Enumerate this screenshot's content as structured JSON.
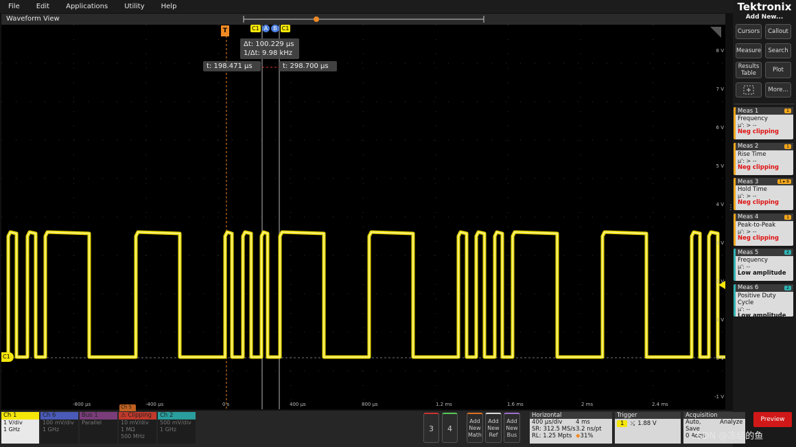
{
  "menu": [
    "File",
    "Edit",
    "Applications",
    "Utility",
    "Help"
  ],
  "waveform_title": "Waveform View",
  "brand": "Tektronix",
  "add_new": "Add New...",
  "side_buttons": [
    "Cursors",
    "Callout",
    "Measure",
    "Search",
    "Results Table",
    "Plot",
    "More..."
  ],
  "trigger_marker": "T",
  "cursor_tags": [
    "C1",
    "A",
    "B",
    "C1"
  ],
  "ch1_tag": "C1",
  "cursor_readouts": {
    "delta_t": "Δt: 100.229 µs",
    "inv_delta_t": "1/Δt: 9.98 kHz",
    "ta": "t: 198.471 µs",
    "tb": "t: 298.700 µs"
  },
  "volt_labels": [
    "8 V",
    "7 V",
    "6 V",
    "5 V",
    "4 V",
    "3 V",
    "2 V",
    "1 V",
    "0 V",
    "-1 V"
  ],
  "time_labels": [
    "-800 µs",
    "-400 µs",
    "0 s",
    "400 µs",
    "800 µs",
    "1.2 ms",
    "1.6 ms",
    "2 ms",
    "2.4 ms"
  ],
  "measurements": [
    {
      "title": "Meas 1",
      "name": "Frequency",
      "mu": "µ': > --",
      "status": "Neg clipping",
      "badge": "1",
      "badge_color": "#f2a71e",
      "status_color": "#e01010"
    },
    {
      "title": "Meas 2",
      "name": "Rise Time",
      "mu": "µ': > --",
      "status": "Neg clipping",
      "badge": "1",
      "badge_color": "#f2a71e",
      "status_color": "#e01010"
    },
    {
      "title": "Meas 3",
      "name": "Hold Time",
      "mu": "µ': > --",
      "status": "Neg clipping",
      "badge": "1 ▸ 6",
      "badge_color": "#f2a71e",
      "status_color": "#e01010"
    },
    {
      "title": "Meas 4",
      "name": "Peak-to-Peak",
      "mu": "µ': > --",
      "status": "Neg clipping",
      "badge": "1",
      "badge_color": "#f2a71e",
      "status_color": "#e01010"
    },
    {
      "title": "Meas 5",
      "name": "Frequency",
      "mu": "µ': --",
      "status": "Low amplitude",
      "badge": "2",
      "badge_color": "#31b3b3",
      "status_color": "#111111"
    },
    {
      "title": "Meas 6",
      "name": "Positive Duty Cycle",
      "mu": "µ': --",
      "status": "Low amplitude",
      "badge": "2",
      "badge_color": "#31b3b3",
      "status_color": "#111111"
    }
  ],
  "channels": [
    {
      "title": "Ch 1",
      "l1": "1 V/div",
      "l2": "",
      "l3": "1 GHz",
      "color": "#f5e60a",
      "bg": "#e9e9e9",
      "tc": "#111"
    },
    {
      "title": "Ch 6",
      "l1": "100 mV/div",
      "l2": "",
      "l3": "1 GHz",
      "color": "#4a5ab8",
      "bg": "#1d1d1d",
      "tc": "#777"
    },
    {
      "title": "Bus 1",
      "l1": "Parallel",
      "l2": "",
      "l3": "",
      "color": "#7a3d7a",
      "bg": "#1d1d1d",
      "tc": "#777"
    },
    {
      "title": "⚠ Clipping",
      "l1": "10 mV/div",
      "l2": "1 MΩ",
      "l3": "500 MHz",
      "color": "#c0392b",
      "bg": "#1d1d1d",
      "tc": "#777"
    },
    {
      "title": "Ch 2",
      "l1": "500 mV/div",
      "l2": "",
      "l3": "1 GHz",
      "color": "#2a9d9d",
      "bg": "#1d1d1d",
      "tc": "#777"
    }
  ],
  "ch5_tab": "Ch 5",
  "num_buttons": [
    "3",
    "4"
  ],
  "add_buttons": [
    "Add New Math",
    "Add New Ref",
    "Add New Bus"
  ],
  "horizontal": {
    "title": "Horizontal",
    "l1a": "400 µs/div",
    "l1b": "4 ms",
    "l2a": "SR: 312.5 MS/s",
    "l2b": "3.2 ns/pt",
    "l3a": "RL: 1.25 Mpts",
    "l3b": "31%"
  },
  "trigger": {
    "title": "Trigger",
    "ch": "1",
    "level": "1.88 V"
  },
  "acquisition": {
    "title": "Acquisition",
    "l1a": "Auto,",
    "l1b": "Analyze",
    "l2": "Save",
    "l3": "0 Acqs"
  },
  "preview": "Preview",
  "watermark": "CSDN @冻结的鱼",
  "colors": {
    "ch1": "#f5e60a",
    "trigger": "#f08a24",
    "cursor": "#9a9a9a",
    "plot_bg": "#000000",
    "accent": "#f2a71e"
  }
}
